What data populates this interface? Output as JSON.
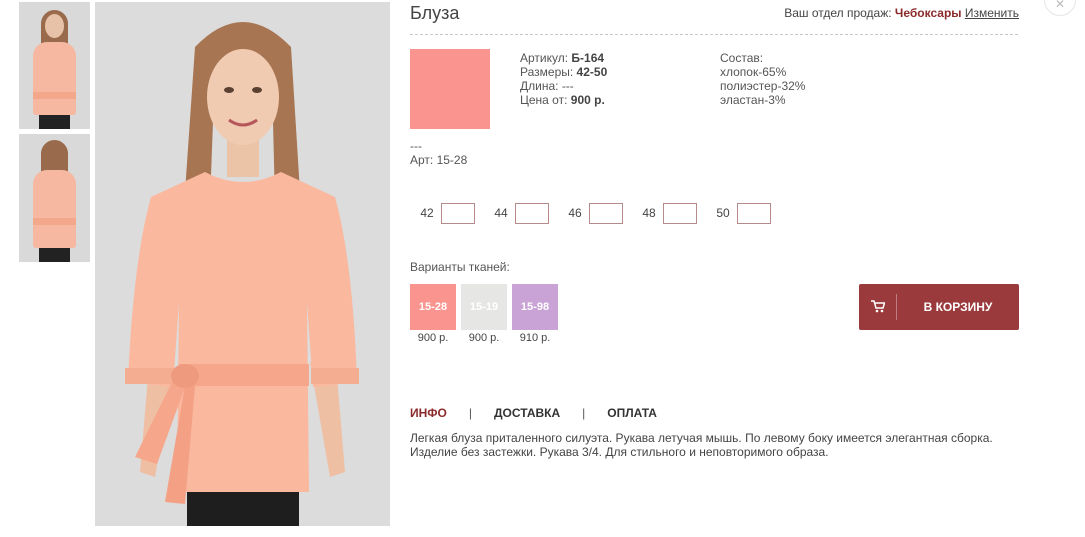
{
  "product": {
    "title": "Блуза",
    "article_label": "Артикул: ",
    "article_value": "Б-164",
    "sizes_label": "Размеры: ",
    "sizes_value": "42-50",
    "length_label": "Длина: ",
    "length_value": "---",
    "price_label": "Цена от: ",
    "price_value": "900 р.",
    "swatch_color": "#f9958e",
    "dash": "---",
    "art": "Арт: 15-28"
  },
  "composition": {
    "title": "Состав:",
    "items": [
      "хлопок-65%",
      "полиэстер-32%",
      "эластан-3%"
    ]
  },
  "region": {
    "label": "Ваш отдел продаж: ",
    "city": "Чебоксары",
    "change": "Изменить"
  },
  "sizes": [
    "42",
    "44",
    "46",
    "48",
    "50"
  ],
  "fabrics": {
    "label": "Варианты тканей:",
    "items": [
      {
        "code": "15-28",
        "price": "900 р.",
        "color": "#f9958e"
      },
      {
        "code": "15-19",
        "price": "900 р.",
        "color": "#e6e6e4"
      },
      {
        "code": "15-98",
        "price": "910 р.",
        "color": "#c9a3d6"
      }
    ]
  },
  "cart": {
    "label": "В КОРЗИНУ"
  },
  "tabs": [
    "ИНФО",
    "ДОСТАВКА",
    "ОПЛАТА"
  ],
  "description": "Легкая блуза приталенного силуэта. Рукава летучая мышь. По левому боку имеется элегантная сборка. Изделие без застежки. Рукава 3/4. Для стильного и неповторимого образа.",
  "colors": {
    "accent": "#9b3a3d",
    "link": "#8b2a2a"
  }
}
